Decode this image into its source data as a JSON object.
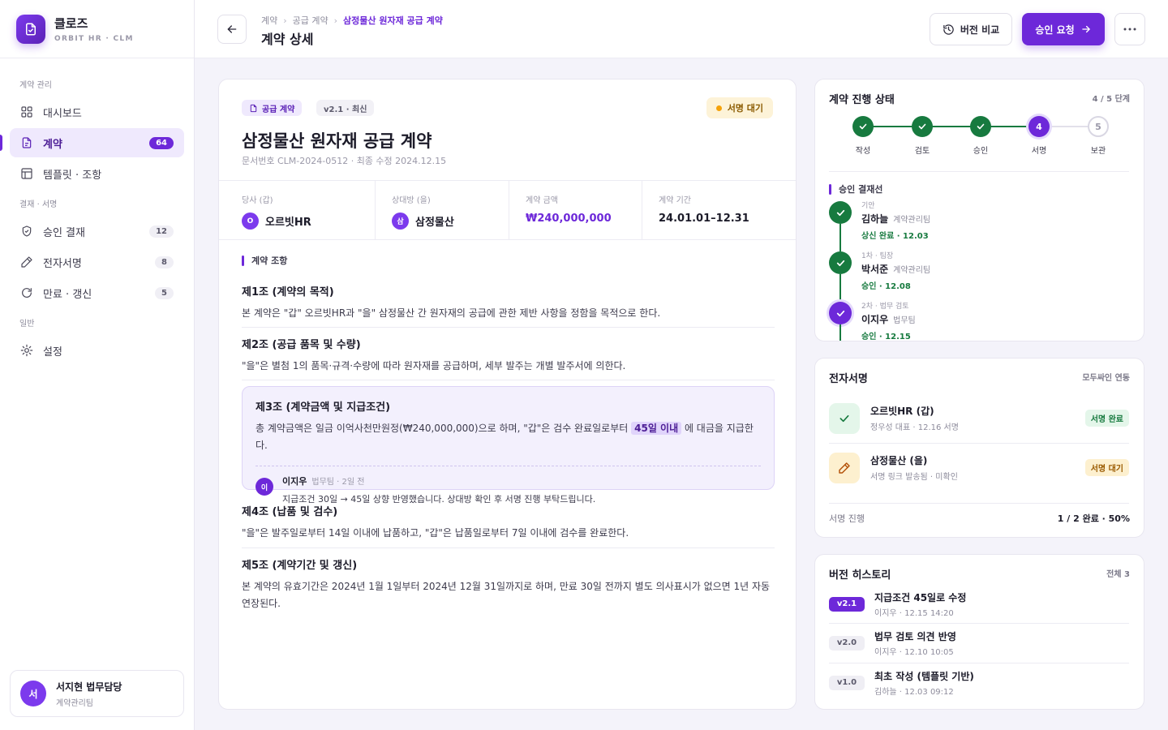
{
  "brand": {
    "name": "클로즈",
    "sub": "ORBIT HR · CLM"
  },
  "nav": {
    "sections": [
      "계약 관리",
      "결재 · 서명",
      "일반"
    ],
    "items": [
      {
        "label": "대시보드",
        "icon": "grid-icon"
      },
      {
        "label": "계약",
        "icon": "document-icon",
        "count": "64",
        "active": true
      },
      {
        "label": "템플릿 · 조항",
        "icon": "template-icon"
      },
      {
        "label": "승인 결재",
        "icon": "shield-check-icon",
        "count": "12"
      },
      {
        "label": "전자서명",
        "icon": "pen-icon",
        "count": "8"
      },
      {
        "label": "만료 · 갱신",
        "icon": "refresh-icon",
        "count": "5"
      },
      {
        "label": "설정",
        "icon": "gear-icon"
      }
    ]
  },
  "user": {
    "initial": "서",
    "name": "서지현 법무담당",
    "team": "계약관리팀"
  },
  "header": {
    "breadcrumbs": [
      "계약",
      "공급 계약",
      "삼정물산 원자재 공급 계약"
    ],
    "title": "계약 상세",
    "version_compare": "버전 비교",
    "request_approval": "승인 요청"
  },
  "doc": {
    "tag_type": "공급 계약",
    "tag_version": "v2.1 · 최신",
    "status": "서명 대기",
    "title": "삼정물산 원자재 공급 계약",
    "meta": "문서번호 CLM-2024-0512 · 최종 수정 2024.12.15",
    "party_a_label": "당사 (갑)",
    "party_a_initial": "O",
    "party_a": "오르빗HR",
    "party_b_label": "상대방 (을)",
    "party_b_initial": "삼",
    "party_b": "삼정물산",
    "amount_label": "계약 금액",
    "amount": "₩240,000,000",
    "period_label": "계약 기간",
    "period": "24.01.01–12.31",
    "clauses_heading": "계약 조항",
    "clauses": [
      {
        "title": "제1조 (계약의 목적)",
        "body": "본 계약은 \"갑\" 오르빗HR과 \"을\" 삼정물산 간 원자재의 공급에 관한 제반 사항을 정함을 목적으로 한다."
      },
      {
        "title": "제2조 (공급 품목 및 수량)",
        "body": "\"을\"은 별첨 1의 품목·규격·수량에 따라 원자재를 공급하며, 세부 발주는 개별 발주서에 의한다."
      },
      {
        "title": "제3조 (계약금액 및 지급조건)",
        "body_pre": "총 계약금액은 일금 이억사천만원정(₩240,000,000)으로 하며, \"갑\"은 검수 완료일로부터",
        "body_hl": "45일 이내",
        "body_post": "에 대금을 지급한다."
      },
      {
        "title": "제4조 (납품 및 검수)",
        "body": "\"을\"은 발주일로부터 14일 이내에 납품하고, \"갑\"은 납품일로부터 7일 이내에 검수를 완료한다."
      },
      {
        "title": "제5조 (계약기간 및 갱신)",
        "body": "본 계약의 유효기간은 2024년 1월 1일부터 2024년 12월 31일까지로 하며, 만료 30일 전까지 별도 의사표시가 없으면 1년 자동 연장된다."
      }
    ],
    "comment": {
      "initial": "이",
      "author": "이지우",
      "meta": "법무팀 · 2일 전",
      "text": "지급조건 30일 → 45일 상향 반영했습니다. 상대방 확인 후 서명 진행 부탁드립니다."
    }
  },
  "progress": {
    "title": "계약 진행 상태",
    "stage": "4 / 5 단계",
    "current_step": 4,
    "steps": [
      "작성",
      "검토",
      "승인",
      "서명",
      "보관"
    ],
    "approval_heading": "승인 결재선",
    "approvals": [
      {
        "role": "기안",
        "name": "김하늘",
        "team": "계약관리팀",
        "status": "상신 완료 · 12.03"
      },
      {
        "role": "1차 · 팀장",
        "name": "박서준",
        "team": "계약관리팀",
        "status": "승인 · 12.08"
      },
      {
        "role": "2차 · 법무 검토",
        "name": "이지우",
        "team": "법무팀",
        "status": "승인 · 12.15"
      }
    ]
  },
  "signature": {
    "title": "전자서명",
    "provider": "모두싸인 연동",
    "parties": [
      {
        "name": "오르빗HR (갑)",
        "sub": "정우성 대표 · 12.16 서명",
        "status": "서명 완료"
      },
      {
        "name": "삼정물산 (을)",
        "sub": "서명 링크 발송됨 · 미확인",
        "status": "서명 대기"
      }
    ],
    "footer_label": "서명 진행",
    "footer_value": "1 / 2 완료 · 50%"
  },
  "history": {
    "title": "버전 히스토리",
    "total": "전체 3",
    "versions": [
      {
        "ver": "v2.1",
        "title": "지급조건 45일로 수정",
        "meta": "이지우 · 12.15 14:20"
      },
      {
        "ver": "v2.0",
        "title": "법무 검토 의견 반영",
        "meta": "이지우 · 12.10 10:05"
      },
      {
        "ver": "v1.0",
        "title": "최초 작성 (템플릿 기반)",
        "meta": "김하늘 · 12.03 09:12"
      }
    ]
  },
  "colors": {
    "accent": "#6d28d9",
    "success": "#177a3f",
    "warning": "#f5a20a"
  }
}
